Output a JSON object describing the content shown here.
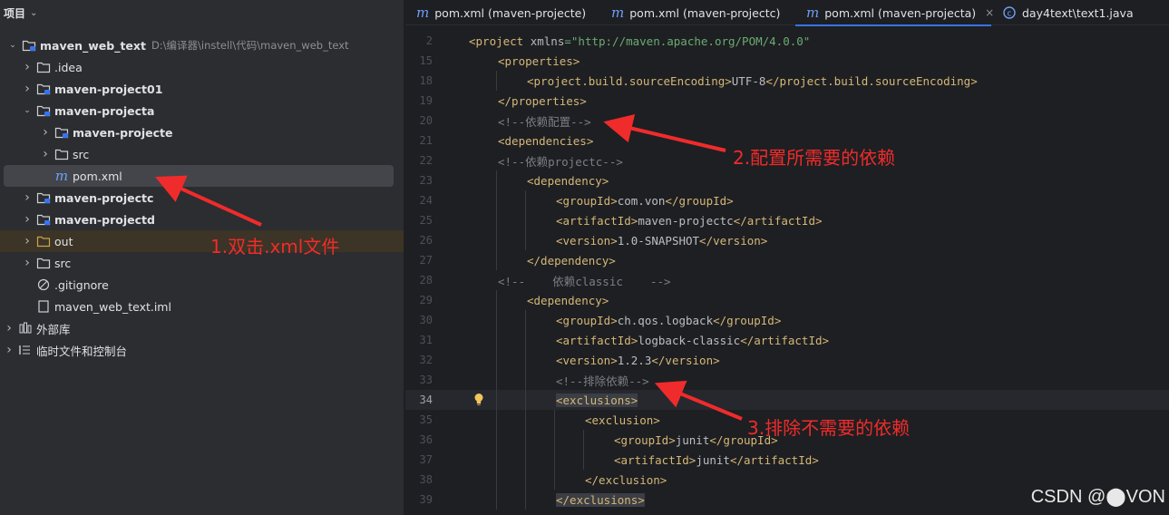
{
  "sidebar": {
    "title": "项目",
    "tree": [
      {
        "label": "maven_web_text",
        "path": "D:\\编译器\\instell\\代码\\maven_web_text",
        "twisty": "down",
        "icon": "module-folder-icon",
        "bold": true
      },
      {
        "label": ".idea",
        "twisty": "right",
        "icon": "folder-icon"
      },
      {
        "label": "maven-project01",
        "twisty": "right",
        "icon": "module-folder-icon",
        "bold": true
      },
      {
        "label": "maven-projecta",
        "twisty": "down",
        "icon": "module-folder-icon",
        "bold": true
      },
      {
        "label": "maven-projecte",
        "twisty": "right",
        "icon": "module-folder-icon",
        "bold": true
      },
      {
        "label": "src",
        "twisty": "right",
        "icon": "folder-icon"
      },
      {
        "label": "pom.xml",
        "twisty": "",
        "icon": "maven-file-icon",
        "selected": true
      },
      {
        "label": "maven-projectc",
        "twisty": "right",
        "icon": "module-folder-icon",
        "bold": true
      },
      {
        "label": "maven-projectd",
        "twisty": "right",
        "icon": "module-folder-icon",
        "bold": true
      },
      {
        "label": "out",
        "twisty": "right",
        "icon": "excluded-folder-icon",
        "highlighted": true
      },
      {
        "label": "src",
        "twisty": "right",
        "icon": "folder-icon"
      },
      {
        "label": ".gitignore",
        "twisty": "",
        "icon": "ignore-file-icon"
      },
      {
        "label": "maven_web_text.iml",
        "twisty": "",
        "icon": "iml-file-icon"
      },
      {
        "label": "外部库",
        "twisty": "right",
        "icon": "library-icon"
      },
      {
        "label": "临时文件和控制台",
        "twisty": "right",
        "icon": "scratch-icon"
      }
    ]
  },
  "tabs": [
    {
      "label": "pom.xml (maven-projecte)",
      "icon": "maven-file-icon"
    },
    {
      "label": "pom.xml (maven-projectc)",
      "icon": "maven-file-icon"
    },
    {
      "label": "pom.xml (maven-projecta)",
      "icon": "maven-file-icon",
      "active": true,
      "close": "×"
    },
    {
      "label": "day4text\\text1.java",
      "icon": "java-class-icon"
    }
  ],
  "code": [
    {
      "n": "2",
      "html": "<span class=\"tg\">&lt;project </span><span class=\"at\">xmlns</span><span class=\"av\">=\"http://maven.apache.org/POM/4.0.0\"</span>",
      "indent": 0
    },
    {
      "n": "15",
      "html": "<span class=\"tg\">&lt;properties&gt;</span>",
      "indent": 1
    },
    {
      "n": "18",
      "html": "<span class=\"tg\">&lt;project.build.sourceEncoding&gt;</span><span class=\"tx\">UTF-8</span><span class=\"tg\">&lt;/project.build.sourceEncoding&gt;</span>",
      "indent": 2
    },
    {
      "n": "19",
      "html": "<span class=\"tg\">&lt;/properties&gt;</span>",
      "indent": 1
    },
    {
      "n": "20",
      "html": "<span class=\"cm\">&lt;!--依赖配置--&gt;</span>",
      "indent": 1
    },
    {
      "n": "21",
      "html": "<span class=\"tg\">&lt;dependencies&gt;</span>",
      "indent": 1
    },
    {
      "n": "22",
      "html": "<span class=\"cm\">&lt;!--依赖projectc--&gt;</span>",
      "indent": 1
    },
    {
      "n": "23",
      "html": "<span class=\"tg\">&lt;dependency&gt;</span>",
      "indent": 2
    },
    {
      "n": "24",
      "html": "<span class=\"tg\">&lt;groupId&gt;</span><span class=\"tx\">com.von</span><span class=\"tg\">&lt;/groupId&gt;</span>",
      "indent": 3
    },
    {
      "n": "25",
      "html": "<span class=\"tg\">&lt;artifactId&gt;</span><span class=\"tx\">maven-projectc</span><span class=\"tg\">&lt;/artifactId&gt;</span>",
      "indent": 3
    },
    {
      "n": "26",
      "html": "<span class=\"tg\">&lt;version&gt;</span><span class=\"tx\">1.0-SNAPSHOT</span><span class=\"tg\">&lt;/version&gt;</span>",
      "indent": 3
    },
    {
      "n": "27",
      "html": "<span class=\"tg\">&lt;/dependency&gt;</span>",
      "indent": 2
    },
    {
      "n": "28",
      "html": "<span class=\"cm\">&lt;!--    依赖classic    --&gt;</span>",
      "indent": 1
    },
    {
      "n": "29",
      "html": "<span class=\"tg\">&lt;dependency&gt;</span>",
      "indent": 2
    },
    {
      "n": "30",
      "html": "<span class=\"tg\">&lt;groupId&gt;</span><span class=\"tx\">ch.qos.logback</span><span class=\"tg\">&lt;/groupId&gt;</span>",
      "indent": 3
    },
    {
      "n": "31",
      "html": "<span class=\"tg\">&lt;artifactId&gt;</span><span class=\"tx\">logback-classic</span><span class=\"tg\">&lt;/artifactId&gt;</span>",
      "indent": 3
    },
    {
      "n": "32",
      "html": "<span class=\"tg\">&lt;version&gt;</span><span class=\"tx\">1.2.3</span><span class=\"tg\">&lt;/version&gt;</span>",
      "indent": 3
    },
    {
      "n": "33",
      "html": "<span class=\"cm\">&lt;!--排除依赖--&gt;</span>",
      "indent": 3
    },
    {
      "n": "34",
      "html": "<span class=\"tg hlbox\">&lt;exclusions&gt;</span>",
      "indent": 3,
      "current": true,
      "bulb": true
    },
    {
      "n": "35",
      "html": "<span class=\"tg\">&lt;exclusion&gt;</span>",
      "indent": 4
    },
    {
      "n": "36",
      "html": "<span class=\"tg\">&lt;groupId&gt;</span><span class=\"tx\">junit</span><span class=\"tg\">&lt;/groupId&gt;</span>",
      "indent": 5
    },
    {
      "n": "37",
      "html": "<span class=\"tg\">&lt;artifactId&gt;</span><span class=\"tx\">junit</span><span class=\"tg\">&lt;/artifactId&gt;</span>",
      "indent": 5
    },
    {
      "n": "38",
      "html": "<span class=\"tg\">&lt;/exclusion&gt;</span>",
      "indent": 4
    },
    {
      "n": "39",
      "html": "<span class=\"tg hlbox\">&lt;/exclusions&gt;</span>",
      "indent": 3
    }
  ],
  "annotations": {
    "a1": "1.双击.xml文件",
    "a2": "2.配置所需要的依赖",
    "a3": "3.排除不需要的依赖",
    "color": "#f02b2b"
  },
  "watermark": "CSDN @⬤VON"
}
